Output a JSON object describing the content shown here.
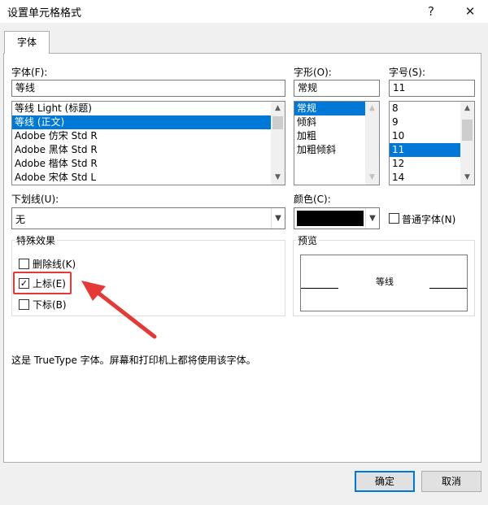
{
  "window": {
    "title": "设置单元格格式",
    "help": "?",
    "close": "✕"
  },
  "tabs": [
    {
      "label": "字体"
    }
  ],
  "font": {
    "label": "字体(F):",
    "value": "等线",
    "items": [
      "等线 Light (标题)",
      "等线 (正文)",
      "Adobe 仿宋 Std R",
      "Adobe 黑体 Std R",
      "Adobe 楷体 Std R",
      "Adobe 宋体 Std L"
    ],
    "selected_index": 1
  },
  "style": {
    "label": "字形(O):",
    "value": "常规",
    "items": [
      "常规",
      "倾斜",
      "加粗",
      "加粗倾斜"
    ],
    "selected_index": 0
  },
  "size": {
    "label": "字号(S):",
    "value": "11",
    "items": [
      "8",
      "9",
      "10",
      "11",
      "12",
      "14"
    ],
    "selected_index": 3
  },
  "underline": {
    "label": "下划线(U):",
    "value": "无"
  },
  "color": {
    "label": "颜色(C):",
    "swatch": "#000000"
  },
  "normal_font": {
    "label": "普通字体(N)",
    "checked": false
  },
  "effects": {
    "title": "特殊效果",
    "strikethrough": {
      "label": "删除线(K)",
      "checked": false
    },
    "superscript": {
      "label": "上标(E)",
      "checked": true
    },
    "subscript": {
      "label": "下标(B)",
      "checked": false
    }
  },
  "preview": {
    "title": "预览",
    "sample": "等线"
  },
  "info_text": "这是 TrueType 字体。屏幕和打印机上都将使用该字体。",
  "buttons": {
    "ok": "确定",
    "cancel": "取消"
  },
  "annotation_color": "#e53935"
}
